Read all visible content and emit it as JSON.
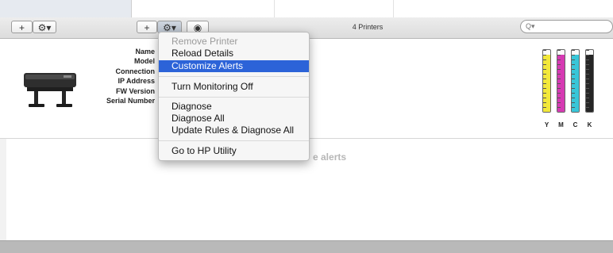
{
  "toolbar_left": {
    "add": "+",
    "gear": "⚙▾"
  },
  "toolbar_main": {
    "add": "+",
    "gear": "⚙▾",
    "monitor": "◉"
  },
  "printer_count": "4 Printers",
  "search": {
    "placeholder": "Q▾"
  },
  "details": {
    "labels": [
      "Name",
      "Model",
      "Connection",
      "IP Address",
      "FW Version",
      "Serial Number"
    ]
  },
  "ink": [
    {
      "label": "Y",
      "color": "#f2e83a",
      "level": 0.92
    },
    {
      "label": "M",
      "color": "#d63ab3",
      "level": 0.92
    },
    {
      "label": "C",
      "color": "#38c6d8",
      "level": 0.92
    },
    {
      "label": "K",
      "color": "#262626",
      "level": 0.92
    }
  ],
  "alerts_text": "e alerts",
  "menu": {
    "items": [
      {
        "label": "Remove Printer",
        "state": "disabled"
      },
      {
        "label": "Reload Details",
        "state": "normal"
      },
      {
        "label": "Customize Alerts",
        "state": "selected"
      },
      {
        "label": "Turn Monitoring Off",
        "state": "normal"
      },
      {
        "label": "Diagnose",
        "state": "normal"
      },
      {
        "label": "Diagnose All",
        "state": "normal"
      },
      {
        "label": "Update Rules & Diagnose All",
        "state": "normal"
      },
      {
        "label": "Go to HP Utility",
        "state": "normal"
      }
    ]
  }
}
